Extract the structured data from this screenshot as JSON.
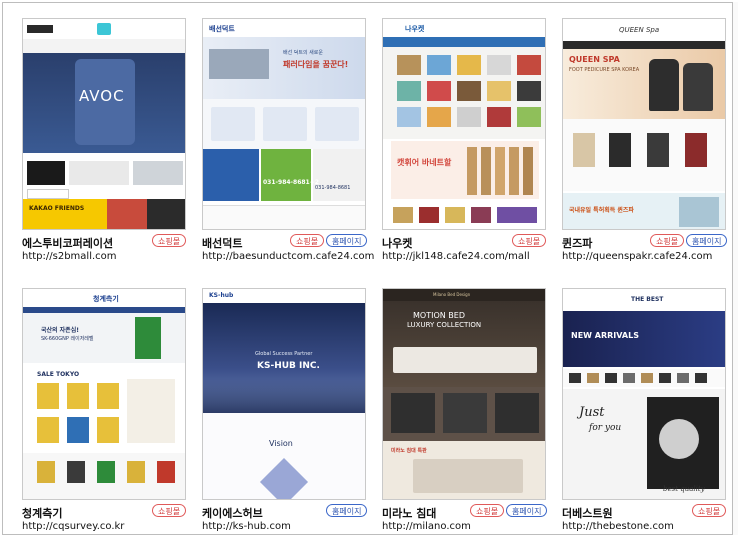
{
  "cards": [
    {
      "name": "에스투비코퍼레이션",
      "url": "http://s2bmall.com",
      "badges": [
        "쇼핑몰"
      ]
    },
    {
      "name": "배선덕트",
      "url": "http://baesunductcom.cafe24.com",
      "badges": [
        "쇼핑몰",
        "홈페이지"
      ]
    },
    {
      "name": "나우켓",
      "url": "http://jkl148.cafe24.com/mall",
      "badges": [
        "쇼핑몰"
      ]
    },
    {
      "name": "퀸즈파",
      "url": "http://queenspakr.cafe24.com",
      "badges": [
        "쇼핑몰",
        "홈페이지"
      ]
    },
    {
      "name": "청계측기",
      "url": "http://cqsurvey.co.kr",
      "badges": [
        "쇼핑몰"
      ]
    },
    {
      "name": "케이에스허브",
      "url": "http://ks-hub.com",
      "badges": [
        "홈페이지"
      ]
    },
    {
      "name": "미라노 침대",
      "url": "http://milano.com",
      "badges": [
        "쇼핑몰",
        "홈페이지"
      ]
    },
    {
      "name": "더베스트원",
      "url": "http://thebestone.com",
      "badges": [
        "쇼핑몰"
      ]
    }
  ],
  "thumbs": {
    "s2b": {
      "hero": "AVOC",
      "banner": "KAKAO FRIENDS"
    },
    "duct": {
      "logo": "배선덕트",
      "hero_line1": "배선 덕트의 새로운",
      "hero_line2": "패러다임을 꿈꾼다!",
      "phone1": "031-984-8681~2",
      "phone2": "031-984-8681"
    },
    "nau": {
      "logo": "나우켓",
      "promo": "캣휘어 바네트할"
    },
    "queen": {
      "logo": "QUEEN Spa",
      "title": "QUEEN SPA",
      "subtitle": "FOOT PEDICURE SPA KOREA",
      "promo": "국내유일 특허획득 퀸즈파"
    },
    "cq": {
      "logo": "청계측기",
      "hero1": "국산의 자존심!",
      "hero2": "SK-660GNP 레이저레벨",
      "sale": "SALE TOKYO"
    },
    "ks": {
      "logo": "KS-hub",
      "tag": "Global Success Partner",
      "hero": "KS-HUB INC.",
      "section": "Vision"
    },
    "milano": {
      "logo": "Milano Bed Design",
      "hero1": "MOTION BED",
      "hero2": "LUXURY COLLECTION",
      "promo": "미라노 침대 특판"
    },
    "best": {
      "logo": "THE BEST",
      "hero": "NEW ARRIVALS",
      "script1": "Just",
      "script2": "for you",
      "tag": "best quality"
    }
  },
  "colors": {
    "shop": "#d23b3b",
    "home": "#2f56b0",
    "navy": "#1d2f5e"
  }
}
